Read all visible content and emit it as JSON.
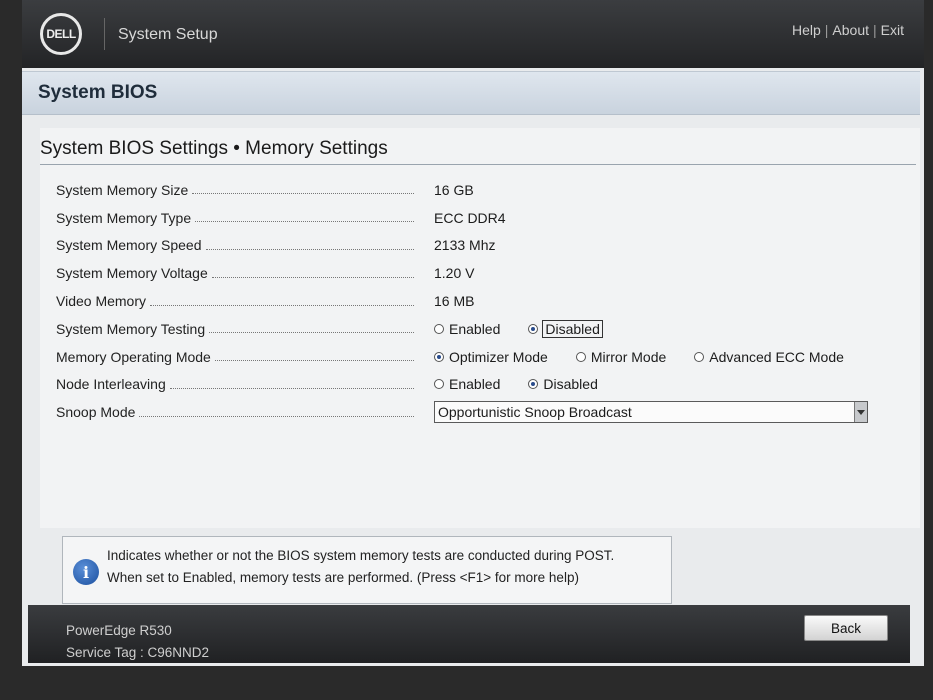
{
  "header": {
    "brand": "DELL",
    "app_title": "System Setup",
    "links": [
      "Help",
      "About",
      "Exit"
    ]
  },
  "section": {
    "title": "System BIOS",
    "page_title": "System BIOS Settings • Memory Settings"
  },
  "settings": [
    {
      "label": "System Memory Size",
      "value": "16 GB"
    },
    {
      "label": "System Memory Type",
      "value": "ECC DDR4"
    },
    {
      "label": "System Memory Speed",
      "value": "2133 Mhz"
    },
    {
      "label": "System Memory Voltage",
      "value": "1.20 V"
    },
    {
      "label": "Video Memory",
      "value": "16 MB"
    },
    {
      "label": "System Memory Testing",
      "options": [
        "Enabled",
        "Disabled"
      ],
      "selected": "Disabled"
    },
    {
      "label": "Memory Operating Mode",
      "options": [
        "Optimizer Mode",
        "Mirror Mode",
        "Advanced ECC Mode"
      ],
      "selected": "Optimizer Mode"
    },
    {
      "label": "Node Interleaving",
      "options": [
        "Enabled",
        "Disabled"
      ],
      "selected": "Disabled"
    },
    {
      "label": "Snoop Mode",
      "dropdown_value": "Opportunistic Snoop Broadcast"
    }
  ],
  "help": {
    "line1": "Indicates whether or not the BIOS system memory tests are conducted during POST.",
    "line2": "When set to Enabled, memory tests are performed. (Press <F1> for more help)"
  },
  "footer": {
    "model": "PowerEdge R530",
    "service_tag": "Service Tag : C96NND2",
    "back_label": "Back"
  },
  "colors": {
    "header_bg": "#2c2d30",
    "window_bg": "#e9ebed",
    "section_header_bg": "#d3dbe4",
    "radio_selected": "#2a4c8c",
    "info_icon": "#1b4f9e"
  }
}
